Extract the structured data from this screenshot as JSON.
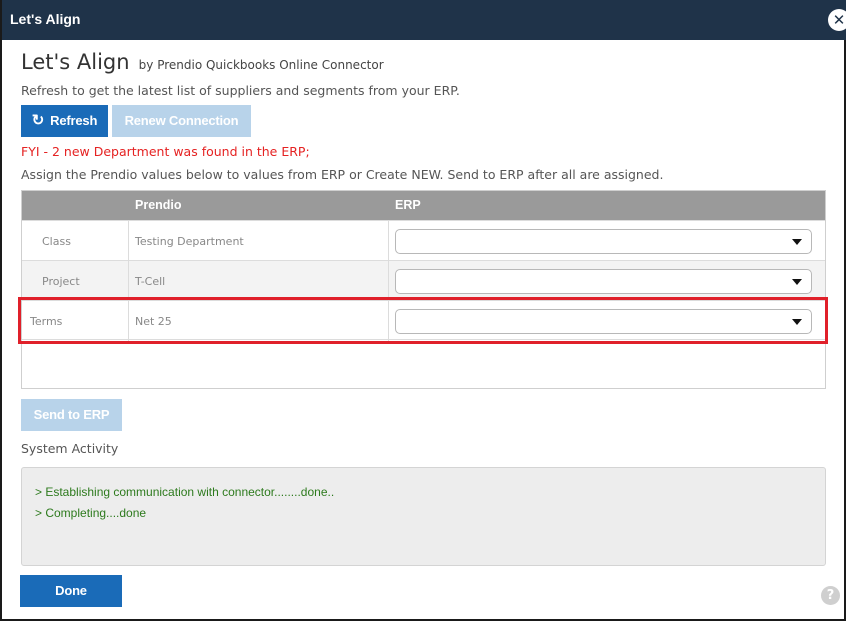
{
  "window": {
    "title": "Let's Align",
    "close_glyph": "✕"
  },
  "heading": {
    "title": "Let's Align",
    "subtitle": "by Prendio Quickbooks Online Connector"
  },
  "refresh_hint": "Refresh to get the latest list of suppliers and segments from your ERP.",
  "buttons": {
    "refresh_label": "Refresh",
    "refresh_icon": "refresh-icon",
    "renew_label": "Renew Connection",
    "send_label": "Send to ERP",
    "done_label": "Done"
  },
  "fyi_message": "FYI - 2 new Department was found in the ERP;",
  "assign_text": "Assign the Prendio values below to values from ERP or Create NEW. Send to ERP after all are assigned.",
  "table": {
    "columns": [
      "",
      "Prendio",
      "ERP"
    ],
    "rows": [
      {
        "segment": "Class",
        "prendio": "Testing Department",
        "erp": ""
      },
      {
        "segment": "Project",
        "prendio": "T-Cell",
        "erp": ""
      },
      {
        "segment": "Terms",
        "prendio": "Net 25",
        "erp": ""
      }
    ]
  },
  "system_activity": {
    "label": "System Activity",
    "lines": [
      "> Establishing communication with connector........done..",
      "> Completing....done"
    ]
  },
  "help_glyph": "?",
  "colors": {
    "titlebar": "#1f3349",
    "primary_button": "#1a6bb8",
    "disabled_button": "#b8d3ea",
    "alert_text": "#e52222",
    "activity_text": "#2d7a1d",
    "highlight_border": "#e0202a"
  }
}
